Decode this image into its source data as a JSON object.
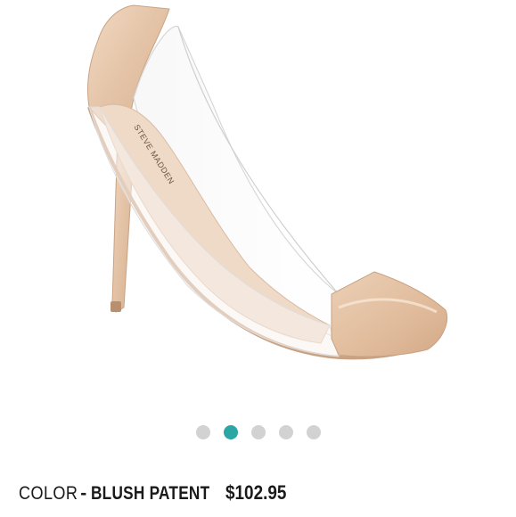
{
  "product": {
    "image_alt": "Clear vinyl stiletto pump in blush patent",
    "brand_insole_text": "STEVE MADDEN",
    "colors": {
      "patent": "#e6c8ad",
      "accent": "#2aa6a4",
      "dot_inactive": "#d2d2d2"
    }
  },
  "carousel": {
    "active_index": 1,
    "dots": [
      "image-1",
      "image-2",
      "image-3",
      "image-4",
      "image-5"
    ]
  },
  "color_row": {
    "label": "COLOR",
    "separator": "-",
    "value": "BLUSH PATENT",
    "price": "$102.95"
  }
}
